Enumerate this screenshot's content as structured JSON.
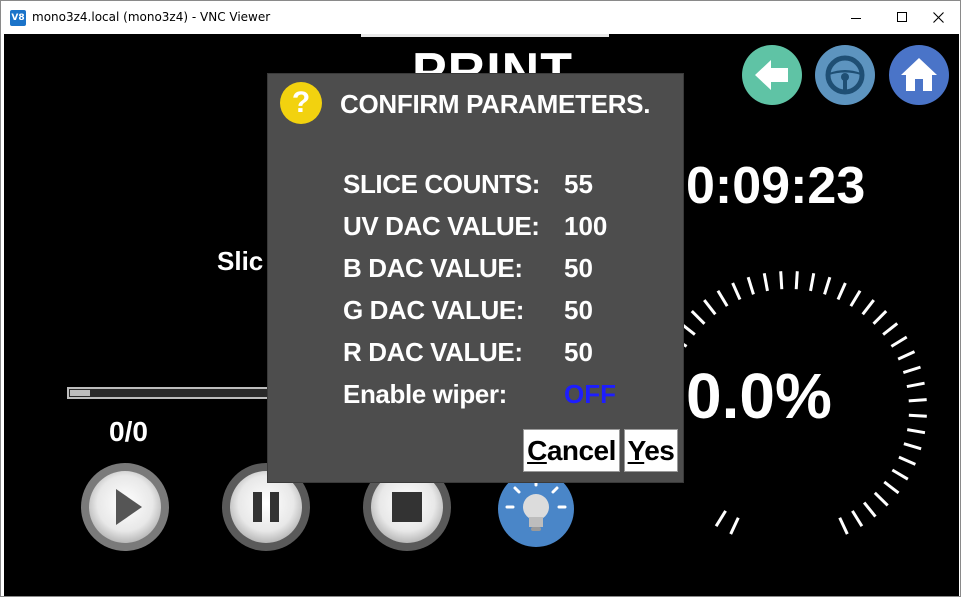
{
  "window": {
    "title": "mono3z4.local (mono3z4) - VNC Viewer",
    "app_icon_text": "V8"
  },
  "screen": {
    "page_title": "PRINT",
    "timer": "0:09:23",
    "percent": "0.0%",
    "slice_label": "Slic",
    "count": "0/0",
    "progress_fraction": 0.1,
    "icons": {
      "back": "back-arrow-icon",
      "drive": "steering-wheel-icon",
      "home": "home-icon",
      "play": "play-icon",
      "pause": "pause-icon",
      "stop": "stop-icon",
      "light": "light-bulb-icon"
    },
    "colors": {
      "back": "#5fc3a5",
      "drive": "#5d94bf",
      "home": "#4a74c8",
      "light": "#4a86c8"
    }
  },
  "dialog": {
    "icon": "question-icon",
    "icon_glyph": "?",
    "title": "CONFIRM PARAMETERS.",
    "params": [
      {
        "label": "SLICE COUNTS:",
        "value": "55"
      },
      {
        "label": "UV DAC VALUE:",
        "value": "100"
      },
      {
        "label": "B DAC VALUE:",
        "value": "50"
      },
      {
        "label": "G DAC VALUE:",
        "value": "50"
      },
      {
        "label": "R DAC VALUE:",
        "value": "50"
      },
      {
        "label": "Enable wiper:",
        "value": "OFF"
      }
    ],
    "cancel_mnemonic": "C",
    "cancel_rest": "ancel",
    "yes_mnemonic": "Y",
    "yes_rest": "es"
  }
}
